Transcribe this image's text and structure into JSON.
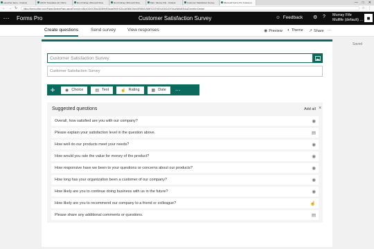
{
  "browser": {
    "tabs": [
      "Launcher demo - Finance",
      "UDOC Templates (3) | Micro",
      "Run Finding | Microsoft Flow",
      "Run Finding | Microsoft Flow",
      "Mail - Murray Fife - Outlook",
      "Customer Satisfaction Survey",
      "Microsoft Forms Pro Customer"
    ],
    "active_tab": 6,
    "url": "https://forms.office.com/Pages/DesignPage.aspx#FormId=v4j5cvGGr0GRqy180BHbRSbgw5fKHH0ZIo4W3jBIQlVkM3RBM1VBMFlCNTNEVUQ0QzZHTkUyWkM4Si4u&Topview=Design"
  },
  "header": {
    "app_name": "Forms Pro",
    "doc_title": "Customer Satisfaction Survey",
    "feedback": "Feedback",
    "user_name": "Murray Fife",
    "user_tenant": "Mulfife (default) ...",
    "avatar": "■"
  },
  "subnav": {
    "tabs": [
      "Create questions",
      "Send survey",
      "View responses"
    ],
    "active": 0,
    "tools": {
      "preview": "Preview",
      "theme": "Theme",
      "share": "Share",
      "more": "···"
    }
  },
  "status": {
    "saved": "Saved"
  },
  "form": {
    "title": "Customer Satisfaction Survey",
    "description": "Customer Satisfaction Survey"
  },
  "add_bar": {
    "types": [
      "Choice",
      "Text",
      "Rating",
      "Date"
    ],
    "more": "···"
  },
  "suggested": {
    "title": "Suggested questions",
    "add_all": "Add all",
    "questions": [
      {
        "text": "Overall, how satisfied are you with our company?",
        "icon": "radio-icon"
      },
      {
        "text": "Please explain your satisfaction level in the question above.",
        "icon": "text-icon"
      },
      {
        "text": "How well do our products meet your needs?",
        "icon": "radio-icon"
      },
      {
        "text": "How would you rate the value for money of the product?",
        "icon": "radio-icon"
      },
      {
        "text": "How responsive have we been to your questions or concerns about our products?",
        "icon": "radio-icon"
      },
      {
        "text": "How long has your organization been a customer of our company?",
        "icon": "radio-icon"
      },
      {
        "text": "How likely are you to continue doing business with us in the future?",
        "icon": "radio-icon"
      },
      {
        "text": "How likely are you to recommend our company to a friend or colleague?",
        "icon": "thumb-icon"
      },
      {
        "text": "Please share any additional comments or questions.",
        "icon": "text-icon"
      }
    ]
  }
}
